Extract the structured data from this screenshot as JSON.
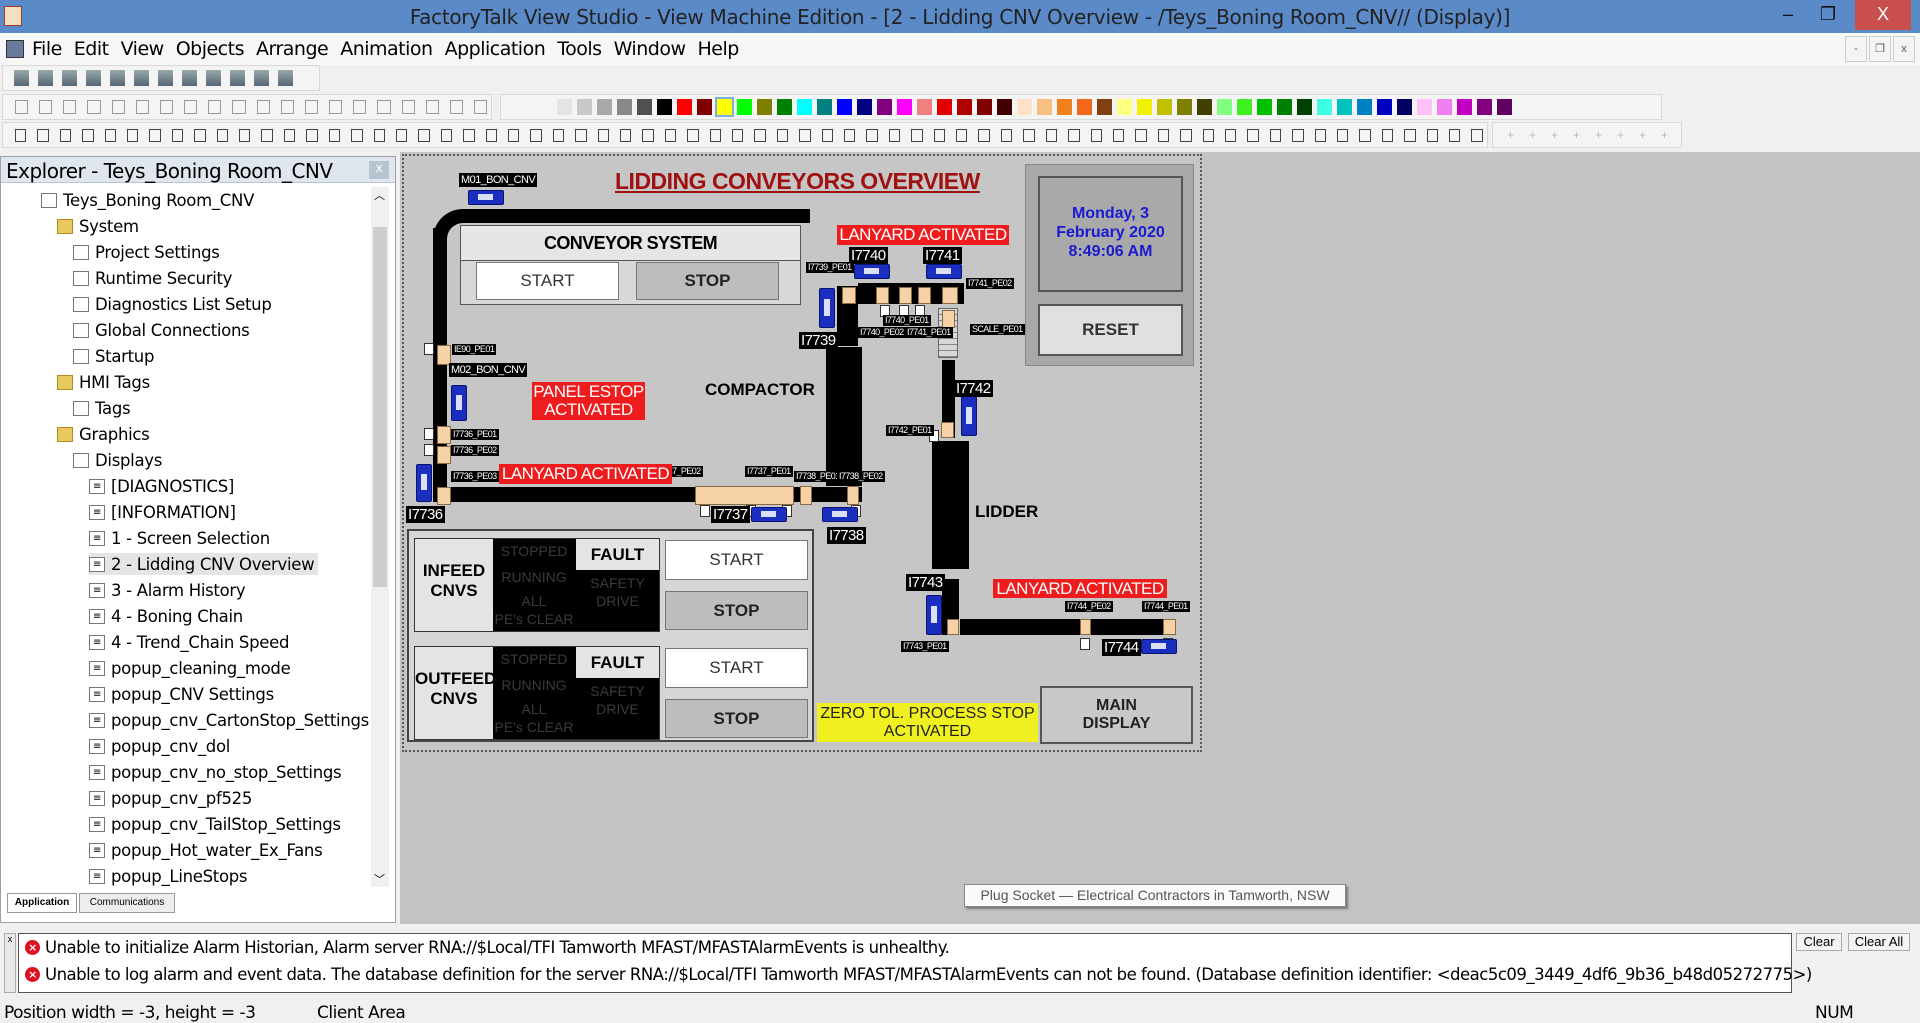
{
  "window": {
    "title": "FactoryTalk View Studio - View Machine Edition - [2 - Lidding CNV Overview - /Teys_Boning Room_CNV// (Display)]",
    "minimize": "–",
    "restore": "❐",
    "close": "X"
  },
  "menu": [
    "File",
    "Edit",
    "View",
    "Objects",
    "Arrange",
    "Animation",
    "Application",
    "Tools",
    "Window",
    "Help"
  ],
  "mdi_controls": [
    "-",
    "❐",
    "x"
  ],
  "palette": {
    "selected": "#ffff00",
    "colors": [
      "#e4e4e4",
      "#c8c8c8",
      "#a8a8a8",
      "#888888",
      "#505050",
      "#000000",
      "#ff0000",
      "#800000",
      "#ffff00",
      "#00ff00",
      "#808000",
      "#008000",
      "#00ffff",
      "#008080",
      "#0000ff",
      "#000080",
      "#800080",
      "#ff00ff",
      "#f08080",
      "#e00000",
      "#b00000",
      "#800000",
      "#400000",
      "#ffe0c8",
      "#f8c080",
      "#f08020",
      "#f06818",
      "#804010",
      "#ffff80",
      "#f0f000",
      "#c0c000",
      "#808000",
      "#404000",
      "#80ff80",
      "#40f020",
      "#00c000",
      "#008000",
      "#004000",
      "#40ffe0",
      "#00c0c0",
      "#0080c0",
      "#0000c0",
      "#000060",
      "#ffc0f8",
      "#f080f0",
      "#c000c0",
      "#800080",
      "#600060"
    ]
  },
  "explorer": {
    "title": "Explorer - Teys_Boning Room_CNV",
    "close": "x",
    "tree": [
      {
        "label": "Teys_Boning Room_CNV",
        "icon": "project-icon"
      },
      {
        "label": "System",
        "icon": "folder-icon"
      },
      {
        "label": "Project Settings",
        "icon": "settings-icon"
      },
      {
        "label": "Runtime Security",
        "icon": "key-icon"
      },
      {
        "label": "Diagnostics List Setup",
        "icon": "diagnostics-icon"
      },
      {
        "label": "Global Connections",
        "icon": "globe-icon"
      },
      {
        "label": "Startup",
        "icon": "flag-icon"
      },
      {
        "label": "HMI Tags",
        "icon": "folder-icon"
      },
      {
        "label": "Tags",
        "icon": "tag-icon"
      },
      {
        "label": "Graphics",
        "icon": "folder-icon"
      },
      {
        "label": "Displays",
        "icon": "displays-icon"
      },
      {
        "label": "[DIAGNOSTICS]",
        "icon": "page-icon"
      },
      {
        "label": "[INFORMATION]",
        "icon": "page-icon"
      },
      {
        "label": "1 - Screen Selection",
        "icon": "page-icon"
      },
      {
        "label": "2 - Lidding CNV Overview",
        "icon": "page-icon",
        "selected": true
      },
      {
        "label": "3 - Alarm History",
        "icon": "page-icon"
      },
      {
        "label": "4 - Boning Chain",
        "icon": "page-icon"
      },
      {
        "label": "4 - Trend_Chain Speed",
        "icon": "page-icon"
      },
      {
        "label": "popup_cleaning_mode",
        "icon": "page-icon"
      },
      {
        "label": "popup_CNV Settings",
        "icon": "page-icon"
      },
      {
        "label": "popup_cnv_CartonStop_Settings",
        "icon": "page-icon"
      },
      {
        "label": "popup_cnv_dol",
        "icon": "page-icon"
      },
      {
        "label": "popup_cnv_no_stop_Settings",
        "icon": "page-icon"
      },
      {
        "label": "popup_cnv_pf525",
        "icon": "page-icon"
      },
      {
        "label": "popup_cnv_TailStop_Settings",
        "icon": "page-icon"
      },
      {
        "label": "popup_Hot_water_Ex_Fans",
        "icon": "page-icon"
      },
      {
        "label": "popup_LineStops",
        "icon": "page-icon"
      }
    ],
    "tabs": [
      "Application",
      "Communications"
    ]
  },
  "display": {
    "title": "LIDDING CONVEYORS OVERVIEW",
    "conveyor_system": {
      "title": "CONVEYOR SYSTEM",
      "start": "START",
      "stop": "STOP"
    },
    "date": "Monday, 3 February 2020",
    "time": "8:49:06 AM",
    "reset": "RESET",
    "alarms": {
      "lanyard": "LANYARD ACTIVATED",
      "panel_estop_1": "PANEL ESTOP",
      "panel_estop_2": "ACTIVATED",
      "zero_tol_1": "ZERO TOL. PROCESS STOP",
      "zero_tol_2": "ACTIVATED"
    },
    "areas": {
      "compactor": "COMPACTOR",
      "lidder": "LIDDER"
    },
    "motors": {
      "m01": "M01_BON_CNV",
      "m02": "M02_BON_CNV"
    },
    "conveyors": [
      "I7736",
      "I7737",
      "I7738",
      "I7739",
      "I7740",
      "I7741",
      "I7742",
      "I7743",
      "I7744"
    ],
    "photo_eyes": [
      "IE90_PE01",
      "I7736_PE01",
      "I7736_PE02",
      "I7736_PE03",
      "I7737_PE02",
      "I7737_PE01",
      "I7738_PE01",
      "I7738_PE02",
      "I7739_PE01",
      "I7740_PE01",
      "I7740_PE02",
      "I7741_PE01",
      "I7741_PE02",
      "SCALE_PE01",
      "I7742_PE01",
      "I7743_PE01",
      "I7744_PE02",
      "I7744_PE01"
    ],
    "groups": [
      {
        "name_1": "INFEED",
        "name_2": "CNVS",
        "stopped": "STOPPED",
        "running": "RUNNING",
        "all": "ALL",
        "pes_clear": "PE's CLEAR",
        "fault": "FAULT",
        "safety": "SAFETY",
        "drive": "DRIVE",
        "start": "START",
        "stop": "STOP"
      },
      {
        "name_1": "OUTFEED",
        "name_2": "CNVS",
        "stopped": "STOPPED",
        "running": "RUNNING",
        "all": "ALL",
        "pes_clear": "PE's CLEAR",
        "fault": "FAULT",
        "safety": "SAFETY",
        "drive": "DRIVE",
        "start": "START",
        "stop": "STOP"
      }
    ],
    "main_display_1": "MAIN",
    "main_display_2": "DISPLAY",
    "colors": {
      "alarm_red": "#ee1c1c",
      "title_red": "#a01010",
      "date_blue": "#1a1ad0",
      "zero_tol_yellow": "#f0f020",
      "motor_blue": "#1a2fc0",
      "photo_eye_tan": "#f6d2a6"
    }
  },
  "watermark": "Plug Socket — Electrical Contractors  in Tamworth, NSW",
  "messages": {
    "items": [
      "Unable to initialize Alarm Historian, Alarm server RNA://$Local/TFI Tamworth MFAST/MFASTAlarmEvents is unhealthy.",
      "Unable to log alarm and event data. The database definition for the server RNA://$Local/TFI Tamworth MFAST/MFASTAlarmEvents can not be found. (Database definition identifier: <deac5c09_3449_4df6_9b36_b48d05272775>)"
    ],
    "clear": "Clear",
    "clear_all": "Clear All"
  },
  "status": {
    "position": "Position width = -3, height = -3",
    "area": "Client Area",
    "num": "NUM"
  }
}
